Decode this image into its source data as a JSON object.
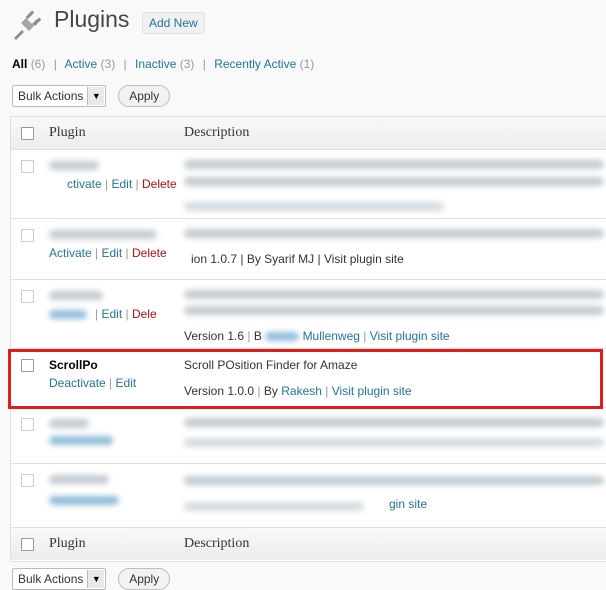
{
  "header": {
    "title": "Plugins",
    "add_new": "Add New"
  },
  "filters": {
    "all": {
      "label": "All",
      "count": "(6)"
    },
    "active": {
      "label": "Active",
      "count": "(3)"
    },
    "inactive": {
      "label": "Inactive",
      "count": "(3)"
    },
    "recently_active": {
      "label": "Recently Active",
      "count": "(1)"
    },
    "separator": "|"
  },
  "bulk": {
    "select_label": "Bulk Actions",
    "apply": "Apply"
  },
  "table": {
    "col_plugin": "Plugin",
    "col_description": "Description"
  },
  "rows": {
    "r1": {
      "actions": [
        "ctivate",
        "Edit",
        "Delete"
      ]
    },
    "r2": {
      "actions": [
        "Activate",
        "Edit",
        "Delete"
      ],
      "meta": "ion 1.0.7 | By Syarif MJ | Visit plugin site"
    },
    "r3": {
      "actions": [
        "Edit",
        "Dele"
      ]
    },
    "r3_meta": {
      "version": "Version 1.6",
      "by": "B",
      "author": "Mullenweg",
      "visit": "Visit plugin site"
    },
    "scrollpo": {
      "name": "ScrollPo",
      "deactivate": "Deactivate",
      "edit": "Edit",
      "description": "Scroll POsition Finder for Amaze",
      "version": "Version 1.0.0",
      "by": "By",
      "author": "Rakesh",
      "visit": "Visit plugin site"
    },
    "r6": {
      "meta_tail": "gin site"
    }
  },
  "colors": {
    "link": "#21759b",
    "delete": "#bc0b0b",
    "highlight": "#e21b1b"
  }
}
